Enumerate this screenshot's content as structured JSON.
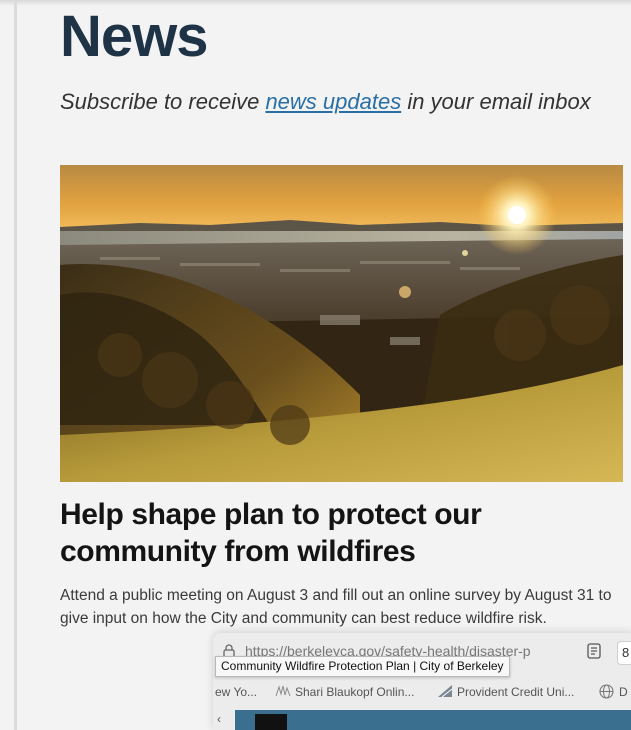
{
  "header": {
    "title": "News",
    "subscribe_prefix": "Subscribe to receive ",
    "subscribe_link": "news updates",
    "subscribe_suffix": " in your email inbox"
  },
  "article": {
    "title": "Help shape plan to protect our community from wildfires",
    "description": "Attend a public meeting on August 3 and fill out an online survey by August 31 to give input on how the City and community can best reduce wildfire risk."
  },
  "browser": {
    "url": "https://berkeleyca.gov/safety-health/disaster-p",
    "tooltip": "Community Wildfire Protection Plan | City of Berkeley",
    "trailing_char": "8",
    "bookmarks": [
      {
        "label": "ew Yo...",
        "icon": "none"
      },
      {
        "label": "Shari Blaukopf Onlin...",
        "icon": "sketch-favicon-icon"
      },
      {
        "label": "Provident Credit Uni...",
        "icon": "provident-favicon-icon"
      },
      {
        "label": "D",
        "icon": "globe-icon"
      }
    ],
    "tab_chevron": "‹"
  },
  "colors": {
    "title": "#1f3347",
    "link": "#2a6ea6",
    "tab_active": "#3a6f8f"
  }
}
